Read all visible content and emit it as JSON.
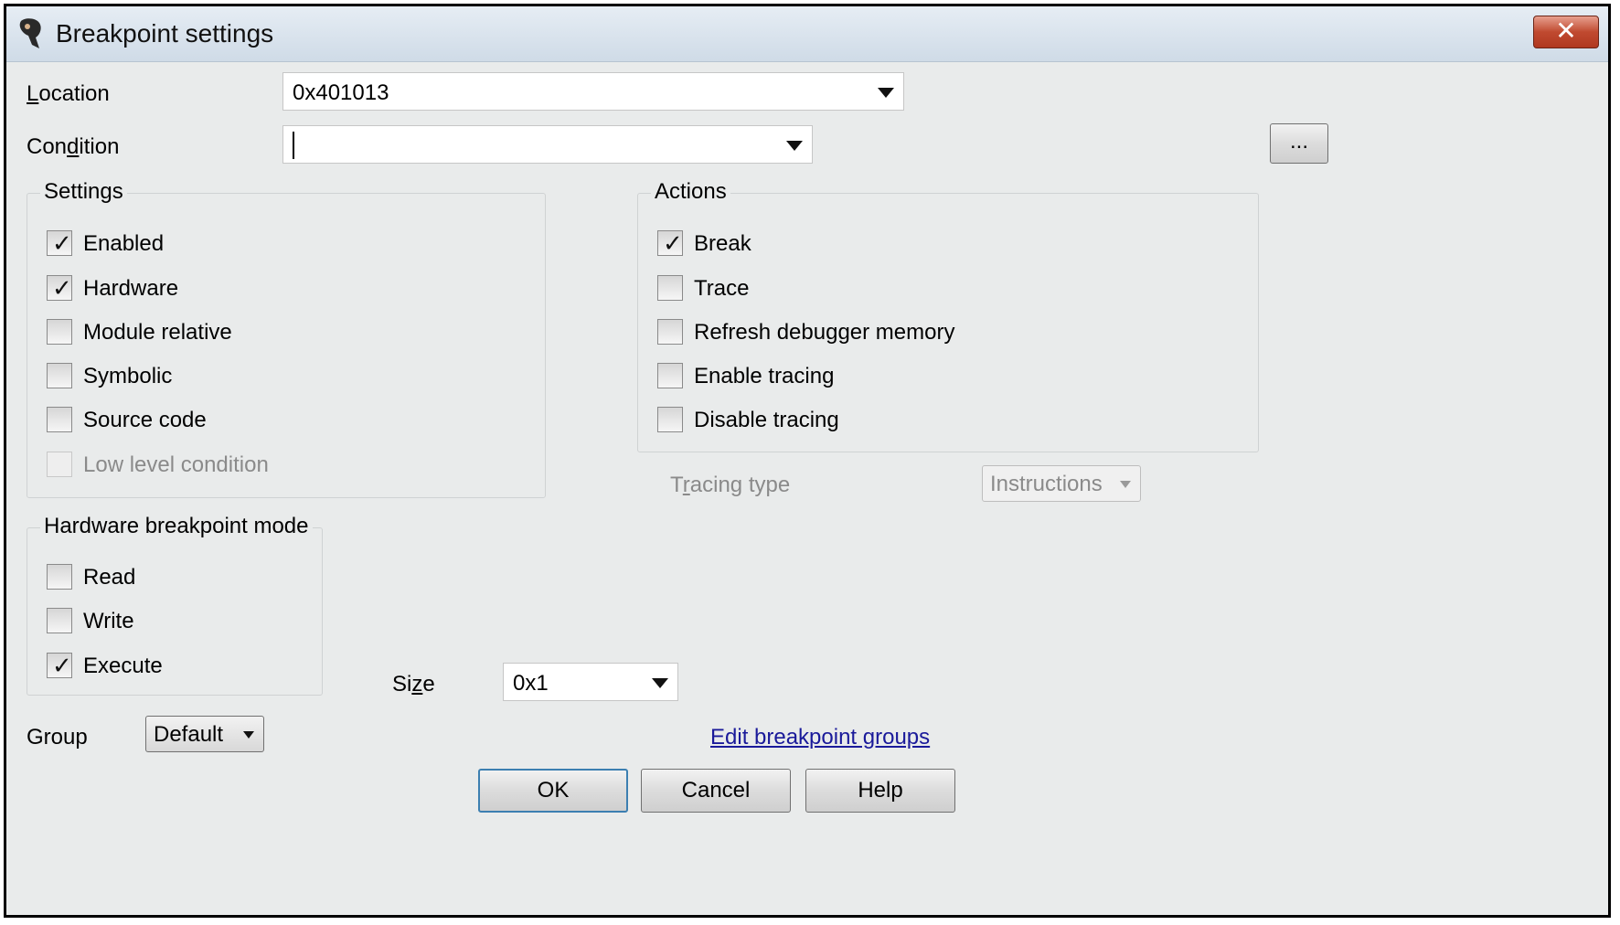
{
  "window": {
    "title": "Breakpoint settings",
    "close_label": "✕"
  },
  "location": {
    "label_pre": "",
    "label_ul": "L",
    "label_post": "ocation",
    "value": "0x401013"
  },
  "condition": {
    "label_pre": "Con",
    "label_ul": "d",
    "label_post": "ition",
    "value": "",
    "browse_label": "..."
  },
  "settings": {
    "title": "Settings",
    "items": [
      {
        "label": "Enabled",
        "checked": true,
        "enabled": true
      },
      {
        "label": "Hardware",
        "checked": true,
        "enabled": true
      },
      {
        "label": "Module relative",
        "checked": false,
        "enabled": true
      },
      {
        "label": "Symbolic",
        "checked": false,
        "enabled": true
      },
      {
        "label": "Source code",
        "checked": false,
        "enabled": true
      },
      {
        "label": "Low level condition",
        "checked": false,
        "enabled": false
      }
    ]
  },
  "actions": {
    "title": "Actions",
    "items": [
      {
        "label": "Break",
        "checked": true
      },
      {
        "label": "Trace",
        "checked": false
      },
      {
        "label": "Refresh debugger memory",
        "checked": false
      },
      {
        "label": "Enable tracing",
        "checked": false
      },
      {
        "label": "Disable tracing",
        "checked": false
      }
    ]
  },
  "tracing_type": {
    "label_pre": "T",
    "label_ul": "r",
    "label_post": "acing type",
    "value": "Instructions"
  },
  "hw_mode": {
    "title": "Hardware breakpoint mode",
    "items": [
      {
        "label": "Read",
        "checked": false
      },
      {
        "label": "Write",
        "checked": false
      },
      {
        "label": "Execute",
        "checked": true
      }
    ]
  },
  "size": {
    "label_pre": "Si",
    "label_ul": "z",
    "label_post": "e",
    "value": "0x1"
  },
  "group": {
    "label": "Group",
    "value": "Default"
  },
  "edit_groups_link": "Edit breakpoint groups",
  "buttons": {
    "ok": "OK",
    "cancel": "Cancel",
    "help": "Help"
  },
  "check_glyph": "✓"
}
